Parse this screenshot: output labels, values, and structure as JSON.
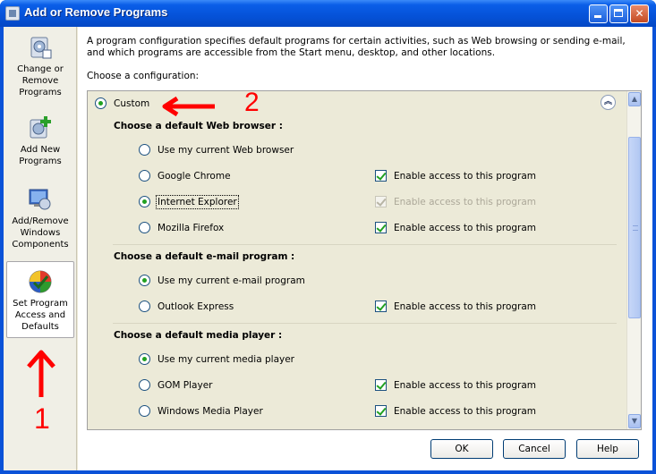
{
  "window": {
    "title": "Add or Remove Programs",
    "titlebar_color": "#0a52d8",
    "controls": [
      "minimize",
      "maximize",
      "close"
    ]
  },
  "sidebar": {
    "items": [
      {
        "label": "Change or Remove Programs",
        "icon": "change-remove-icon"
      },
      {
        "label": "Add New Programs",
        "icon": "add-new-icon"
      },
      {
        "label": "Add/Remove Windows Components",
        "icon": "windows-components-icon"
      },
      {
        "label": "Set Program Access and Defaults",
        "icon": "program-defaults-icon",
        "selected": true
      }
    ]
  },
  "main": {
    "description": "A program configuration specifies default programs for certain activities, such as Web browsing or sending e-mail, and which programs are accessible from the Start menu, desktop, and other locations.",
    "choose_label": "Choose a configuration:",
    "configuration": {
      "label": "Custom",
      "selected": true
    },
    "sections": [
      {
        "header": "Choose a default Web browser :",
        "options": [
          {
            "label": "Use my current Web browser",
            "selected": false,
            "enable": null
          },
          {
            "label": "Google Chrome",
            "selected": false,
            "enable": {
              "label": "Enable access to this program",
              "checked": true,
              "disabled": false
            }
          },
          {
            "label": "Internet Explorer",
            "selected": true,
            "enable": {
              "label": "Enable access to this program",
              "checked": true,
              "disabled": true
            }
          },
          {
            "label": "Mozilla Firefox",
            "selected": false,
            "enable": {
              "label": "Enable access to this program",
              "checked": true,
              "disabled": false
            }
          }
        ]
      },
      {
        "header": "Choose a default e-mail program :",
        "options": [
          {
            "label": "Use my current e-mail program",
            "selected": true,
            "enable": null
          },
          {
            "label": "Outlook Express",
            "selected": false,
            "enable": {
              "label": "Enable access to this program",
              "checked": true,
              "disabled": false
            }
          }
        ]
      },
      {
        "header": "Choose a default media player :",
        "options": [
          {
            "label": "Use my current media player",
            "selected": true,
            "enable": null
          },
          {
            "label": "GOM Player",
            "selected": false,
            "enable": {
              "label": "Enable access to this program",
              "checked": true,
              "disabled": false
            }
          },
          {
            "label": "Windows Media Player",
            "selected": false,
            "enable": {
              "label": "Enable access to this program",
              "checked": true,
              "disabled": false
            }
          }
        ]
      }
    ]
  },
  "buttons": {
    "ok": "OK",
    "cancel": "Cancel",
    "help": "Help"
  },
  "annotations": {
    "color": "#ff0000",
    "marker_1": "1",
    "marker_2": "2"
  }
}
